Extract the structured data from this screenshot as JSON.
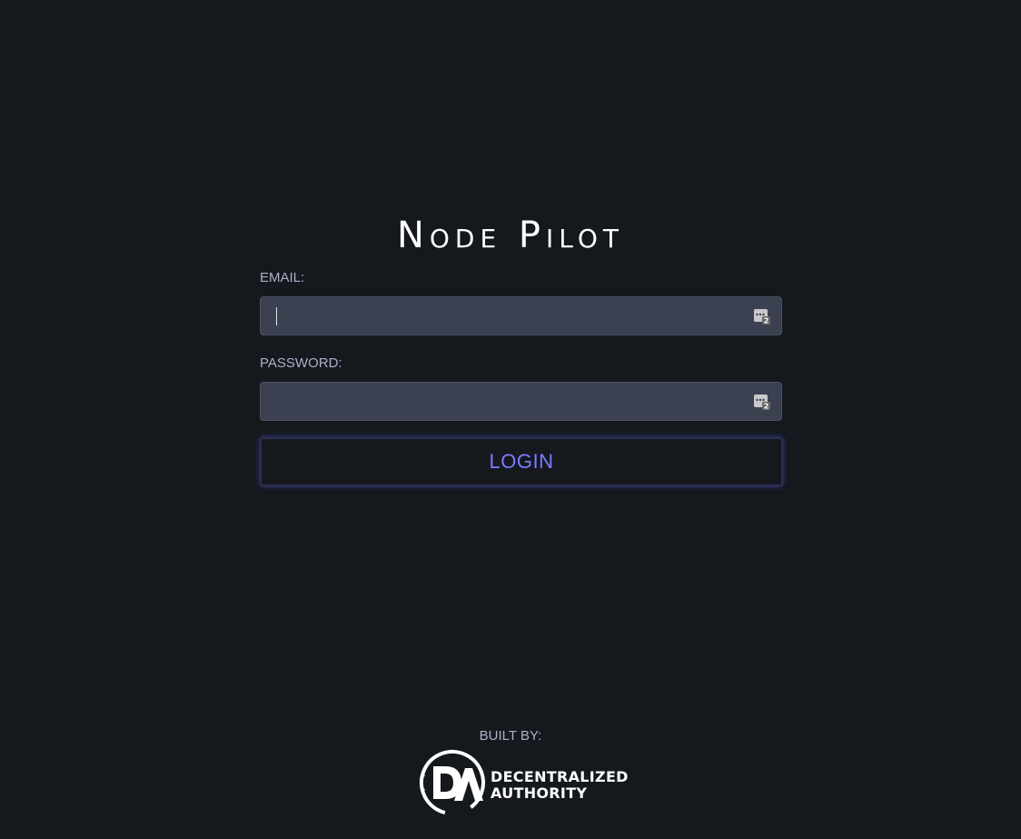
{
  "app": {
    "title": "Node Pilot"
  },
  "form": {
    "email_label": "EMAIL:",
    "email_value": "",
    "password_label": "PASSWORD:",
    "password_value": "",
    "login_label": "LOGIN"
  },
  "footer": {
    "built_by": "BUILT BY:",
    "brand_line1": "DECENTRALIZED",
    "brand_line2": "AUTHORITY",
    "brand_logo_icon": "da-logo-icon"
  },
  "icons": {
    "password_manager": "password-manager-icon"
  },
  "colors": {
    "background": "#15181d",
    "input_bg": "#3b4150",
    "label": "#a9b2c8",
    "accent": "#7b7cff"
  }
}
